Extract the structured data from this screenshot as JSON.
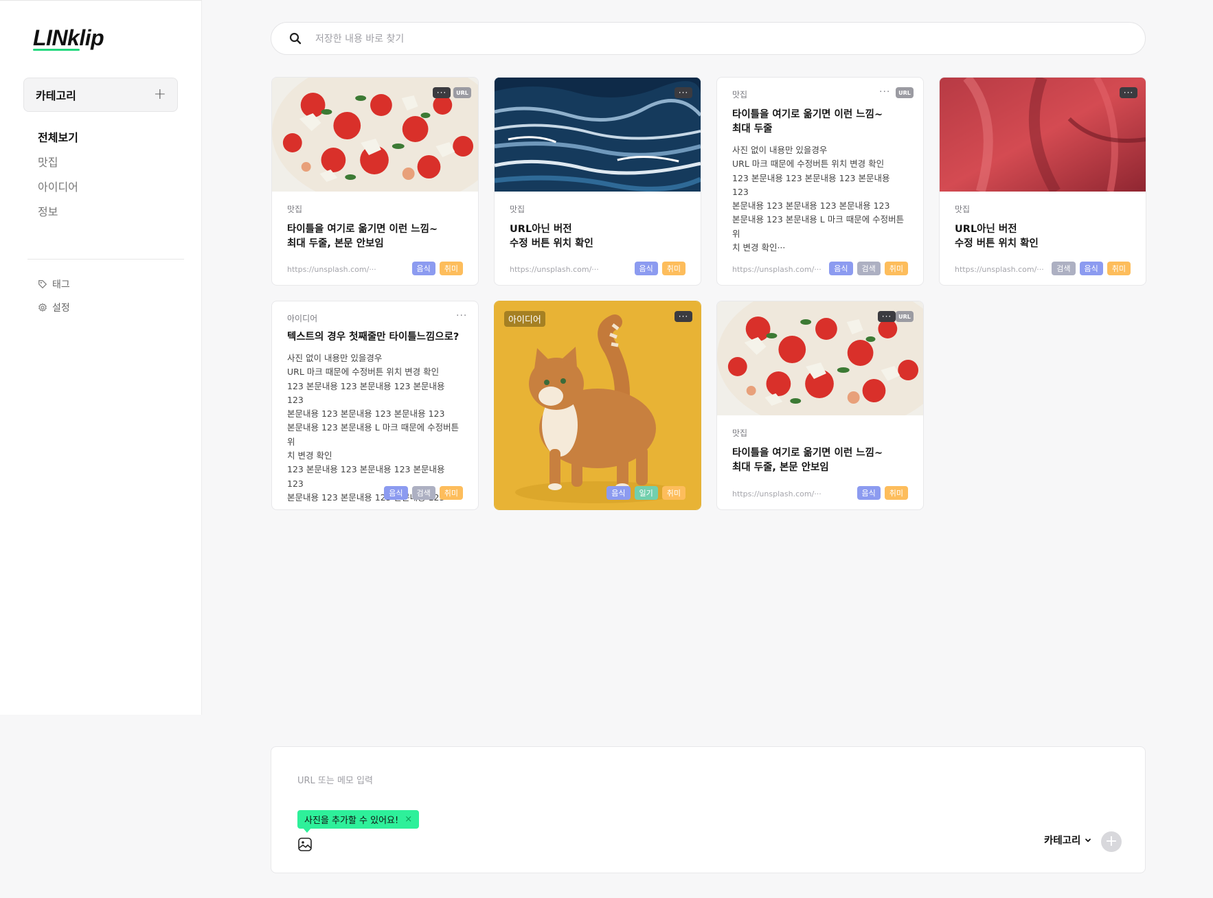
{
  "app": {
    "logo": "LINklip"
  },
  "sidebar": {
    "category_header": "카테고리",
    "items": [
      {
        "label": "전체보기",
        "active": true
      },
      {
        "label": "맛집",
        "active": false
      },
      {
        "label": "아이디어",
        "active": false
      },
      {
        "label": "정보",
        "active": false
      }
    ],
    "sub_items": [
      {
        "label": "태그",
        "icon": "tag-icon"
      },
      {
        "label": "설정",
        "icon": "gear-icon"
      }
    ]
  },
  "search": {
    "placeholder": "저장한 내용 바로 찾기"
  },
  "cards": [
    {
      "category": "맛집",
      "title_line1": "타이틀을 여기로 옮기면 이런 느낌~",
      "title_line2": "최대 두줄, 본문 안보임",
      "url": "https://unsplash.com/···",
      "tags": [
        "음식",
        "취미"
      ],
      "url_badge": "URL"
    },
    {
      "category": "맛집",
      "title_line1": "URL아닌 버전",
      "title_line2": "수정 버튼 위치 확인",
      "url": "https://unsplash.com/···",
      "tags": [
        "음식",
        "취미"
      ]
    },
    {
      "category": "맛집",
      "title_line1": "타이틀을 여기로 옮기면 이런 느낌~",
      "title_line2": "최대 두줄",
      "desc": [
        "사진 없이 내용만 있을경우",
        "URL 마크 때문에 수정버튼 위치 변경 확인",
        "123 본문내용 123 본문내용 123 본문내용 123",
        "본문내용 123 본문내용 123 본문내용 123",
        "본문내용 123 본문내용 L 마크 때문에 수정버튼 위",
        "치 변경 확인···"
      ],
      "url": "https://unsplash.com/···",
      "tags": [
        "음식",
        "검색",
        "취미"
      ],
      "url_badge": "URL"
    },
    {
      "category": "맛집",
      "title_line1": "URL아닌 버전",
      "title_line2": "수정 버튼 위치 확인",
      "url": "https://unsplash.com/···",
      "tags": [
        "검색",
        "음식",
        "취미"
      ]
    },
    {
      "category": "아이디어",
      "title_line1": "텍스트의 경우 첫째줄만 타이틀느낌으로?",
      "desc": [
        "사진 없이 내용만 있을경우",
        "URL 마크 때문에 수정버튼 위치 변경 확인",
        "123 본문내용 123 본문내용 123 본문내용 123",
        "본문내용 123 본문내용 123 본문내용 123",
        "본문내용 123 본문내용 L 마크 때문에 수정버튼 위",
        "치 변경 확인",
        "123 본문내용 123 본문내용 123 본문내용 123",
        "본문내용 123 본문내용 123 본문내용 123···"
      ],
      "tags": [
        "음식",
        "검색",
        "취미"
      ]
    },
    {
      "category": "아이디어",
      "tags": [
        "음식",
        "일기",
        "취미"
      ]
    },
    {
      "category": "맛집",
      "title_line1": "타이틀을 여기로 옮기면 이런 느낌~",
      "title_line2": "최대 두줄, 본문 안보임",
      "url": "https://unsplash.com/···",
      "tags": [
        "음식",
        "취미"
      ],
      "url_badge": "URL"
    }
  ],
  "composer": {
    "placeholder": "URL 또는 메모 입력",
    "tooltip": "사진을 추가할 수 있어요!",
    "tooltip_close": "×",
    "category_select": "카테고리",
    "add_button": "+"
  },
  "colors": {
    "accent": "#2ef09a",
    "tag_food": "#8c9bf0",
    "tag_hobby": "#fdbd5c",
    "tag_search": "#adb0c2",
    "tag_diary": "#72cfae"
  }
}
